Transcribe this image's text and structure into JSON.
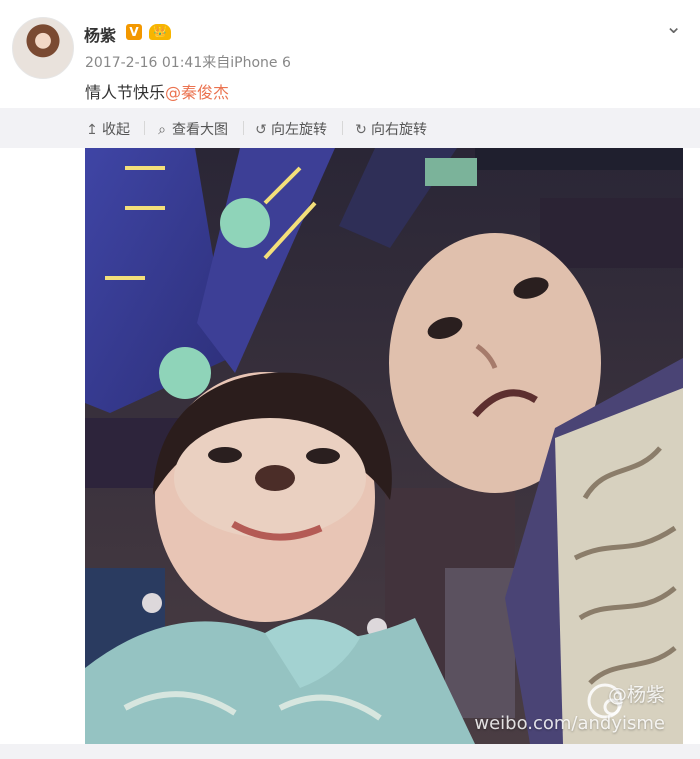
{
  "post": {
    "author": "杨紫",
    "v_badge": "V",
    "member_badge": "会员",
    "meta": "2017-2-16 01:41来自iPhone 6",
    "text_prefix": "情人节快乐",
    "mention": "@秦俊杰",
    "expand_icon": "chevron-down-icon"
  },
  "toolbar": {
    "items": [
      {
        "icon": "collapse-icon",
        "glyph": "↥",
        "label": "收起"
      },
      {
        "icon": "search-icon",
        "glyph": "⌕",
        "label": "查看大图"
      },
      {
        "icon": "rotate-left-icon",
        "glyph": "↺",
        "label": "向左旋转"
      },
      {
        "icon": "rotate-right-icon",
        "glyph": "↻",
        "label": "向右旋转"
      }
    ]
  },
  "image": {
    "watermark_handle": "@杨紫",
    "watermark_url": "weibo.com/andyisme"
  },
  "colors": {
    "mention": "#eb7350",
    "toolbar_bg": "#f2f2f5"
  }
}
